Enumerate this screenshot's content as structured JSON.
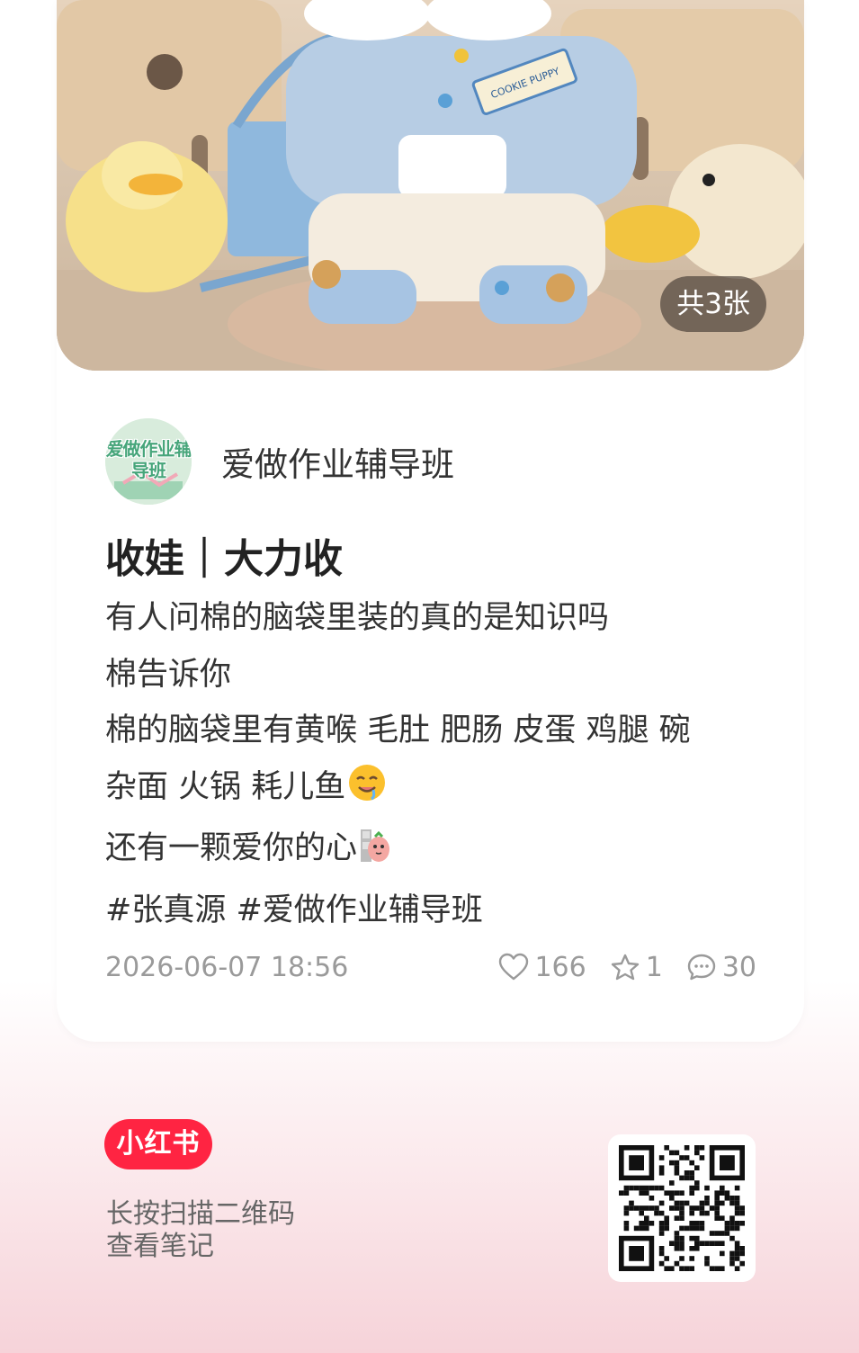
{
  "photo": {
    "count_badge": "共3张",
    "patch_text": "COOKIE PUPPY"
  },
  "author": {
    "avatar_text": "爱做作业辅导班",
    "name": "爱做作业辅导班"
  },
  "post": {
    "title": "收娃｜大力收",
    "lines": [
      "有人问棉的脑袋里装的真的是知识吗",
      "棉告诉你",
      "棉的脑袋里有黄喉 毛肚 肥肠 皮蛋 鸡腿 碗",
      "杂面 火锅 耗儿鱼",
      "还有一颗爱你的心",
      "#张真源 #爱做作业辅导班"
    ],
    "emoji_line4": "drooling-face-emoji",
    "emoji_line5": "sticker-emoji"
  },
  "meta": {
    "date": "2026-06-07 18:56",
    "likes": "166",
    "favorites": "1",
    "comments": "30"
  },
  "footer": {
    "brand": "小红书",
    "scan_line1": "长按扫描二维码",
    "scan_line2": "查看笔记"
  },
  "colors": {
    "brand_red": "#ff2442",
    "text_dark": "#333333",
    "meta_gray": "#9a9a9a"
  }
}
